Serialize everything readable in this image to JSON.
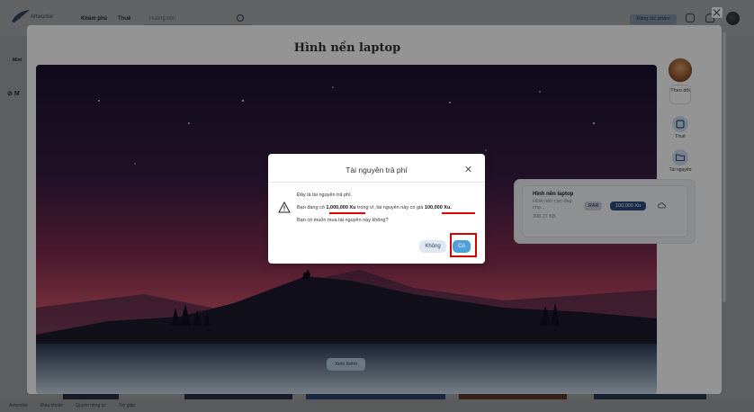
{
  "topbar": {
    "logo_text": "Artworkie",
    "nav": [
      "Khám phá",
      "Thuê",
      "Hoàng hôn"
    ],
    "post_button": "Đăng tác phẩm"
  },
  "background": {
    "side_label_1": "Mini",
    "side_label_2": "M",
    "footer": [
      "Artworkie",
      "Điều khoản",
      "Quyền riêng tư",
      "Trợ giúp"
    ]
  },
  "modal": {
    "title": "Hình nền laptop",
    "see_more": "Xem thêm"
  },
  "rail": {
    "follow": "Theo dõi",
    "hire": "Thuê",
    "resources": "Tài nguyên"
  },
  "resource": {
    "name": "Hình nền laptop",
    "description": "Hình nền cực đẹp cho...",
    "size": "398.27 KB",
    "ext": ".RAR",
    "price": "100,000 Xu"
  },
  "dialog": {
    "title": "Tài nguyên trả phí",
    "line1": "Đây là tài nguyên trả phí.",
    "line2_prefix": "Bạn đang có ",
    "balance": "1,000,000 Xu",
    "line2_mid": " trong ví, tài nguyên này có giá ",
    "price": "100,000 Xu.",
    "line3": "Bạn có muốn mua tài nguyên này không?",
    "no_button": "Không",
    "yes_button": "Có"
  },
  "colors": {
    "accent": "#4f9fdb",
    "price_badge": "#2b4c7e",
    "highlight": "#d40000"
  }
}
